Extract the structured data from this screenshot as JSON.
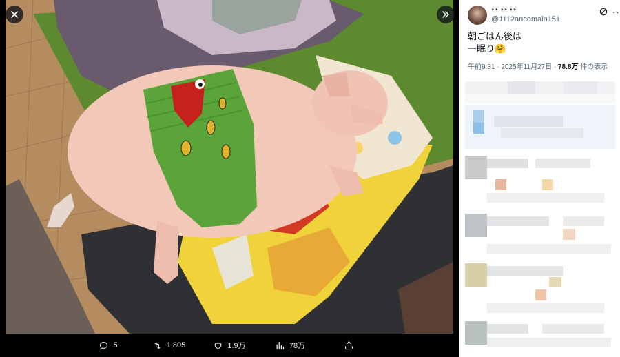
{
  "viewer": {
    "actions": [
      {
        "icon": "reply-icon",
        "count": "5"
      },
      {
        "icon": "retweet-icon",
        "count": "1,805"
      },
      {
        "icon": "like-icon",
        "count": "1.9万"
      },
      {
        "icon": "views-icon",
        "count": "78万"
      },
      {
        "icon": "share-icon",
        "count": ""
      }
    ]
  },
  "tweet": {
    "display_name": "👀👀👀",
    "handle": "@1112ancomain151",
    "text_line1": "朝ごはん後は",
    "text_line2": "一眠り🤗",
    "time": "午前9:31",
    "date": "2025年11月27日",
    "views": "78.8万",
    "views_suffix": "件の表示"
  }
}
